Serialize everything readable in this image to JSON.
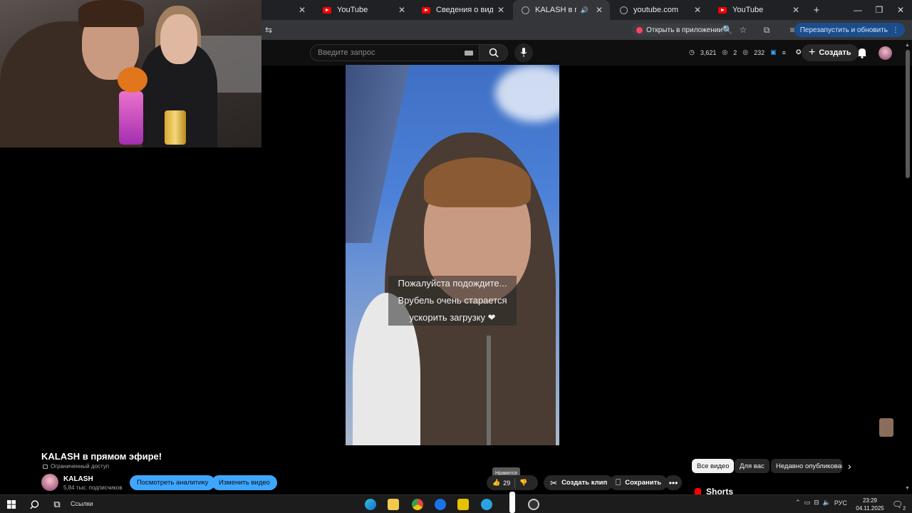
{
  "browser": {
    "tabs": [
      {
        "label": "",
        "close": "✕"
      },
      {
        "label": "YouTube",
        "close": "✕"
      },
      {
        "label": "Сведения о видео - YouTube",
        "close": "✕"
      },
      {
        "label": "KALASH в прямом эфире!",
        "close": "✕"
      },
      {
        "label": "youtube.com",
        "close": "✕"
      },
      {
        "label": "YouTube",
        "close": "✕"
      }
    ],
    "new_tab": "+",
    "minimize": "—",
    "maximize": "❐",
    "close": "✕",
    "open_in_app": "Открыть в приложении",
    "relaunch": "Перезапустить и обновить"
  },
  "youtube": {
    "search_placeholder": "Введите запрос",
    "stats": {
      "time": "3,621",
      "views": "2",
      "other": "232"
    },
    "create": "Создать"
  },
  "video": {
    "overlay_lines": [
      "Пожалуйста подождите...",
      "Врубель очень старается",
      "ускорить загрузку ❤"
    ]
  },
  "info": {
    "title": "KALASH в прямом эфире!",
    "access": "Ограниченный доступ",
    "channel_name": "KALASH",
    "subscribers": "5,84 тыс. подписчиков",
    "analytics_button": "Посмотреть аналитику",
    "edit_button": "Изменить видео",
    "like_tooltip": "Нравится",
    "like_count": "29",
    "clip_button": "Создать клип",
    "save_button": "Сохранить",
    "more": "•••"
  },
  "chips": [
    "Все видео",
    "Для вас",
    "Недавно опубликованные"
  ],
  "shorts_label": "Shorts",
  "taskbar": {
    "links": "Ссылки",
    "lang": "РУС",
    "time": "23:29",
    "date": "04.11.2025",
    "notif_count": "2"
  }
}
